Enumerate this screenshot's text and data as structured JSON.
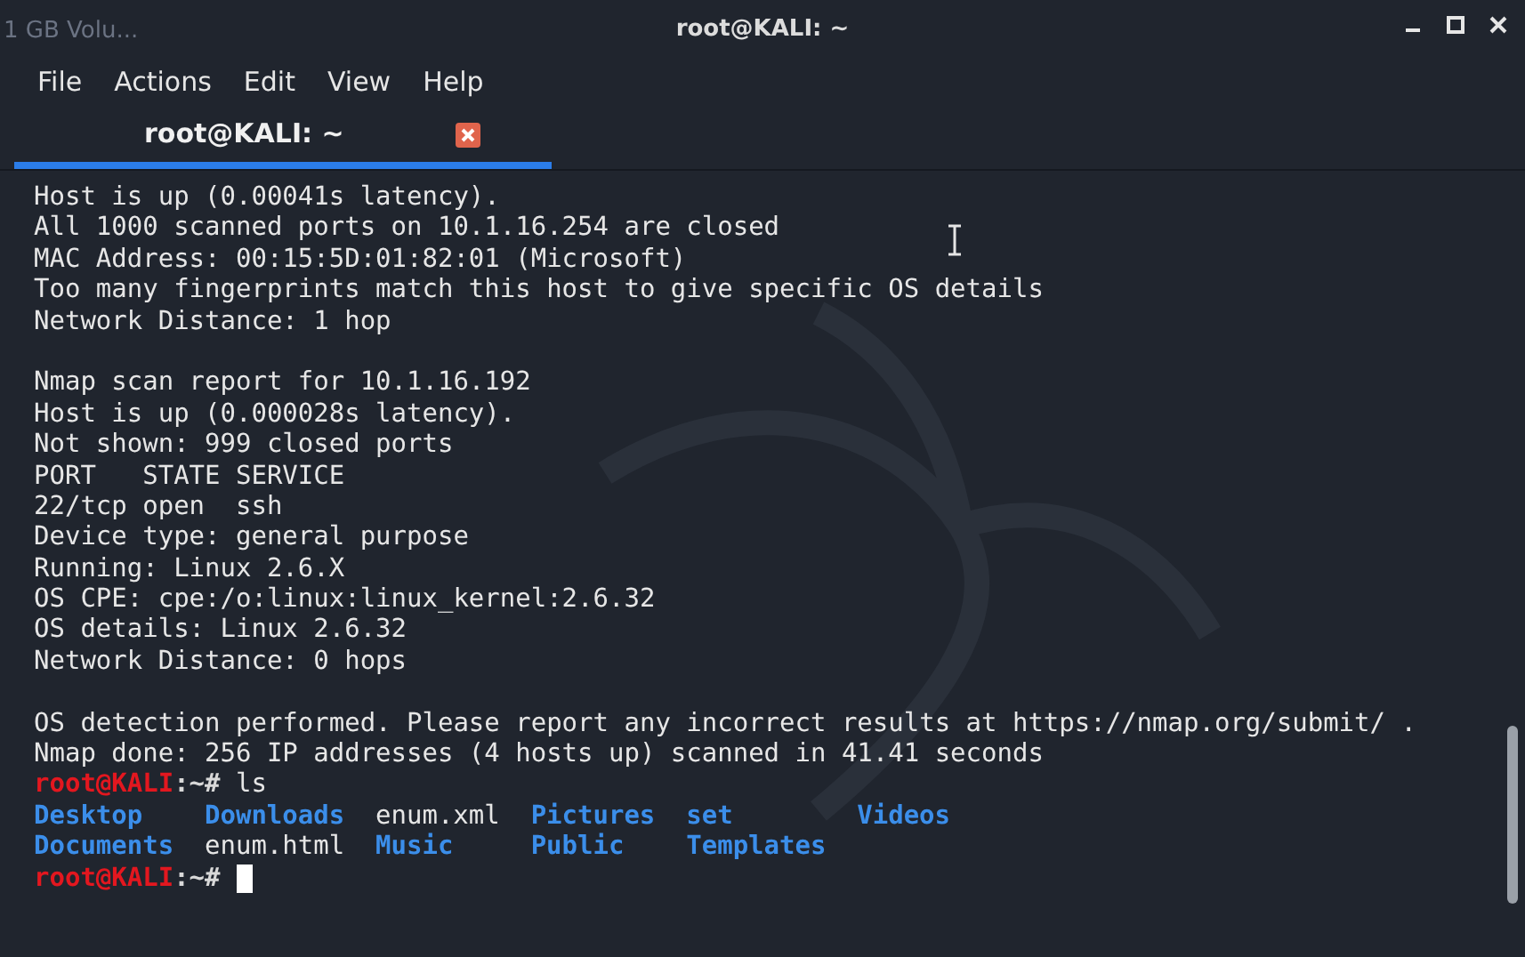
{
  "desktop": {
    "icon_label": "1 GB Volu..."
  },
  "window": {
    "title": "root@KALI: ~"
  },
  "menu": [
    "File",
    "Actions",
    "Edit",
    "View",
    "Help"
  ],
  "tabs": [
    {
      "label": "root@KALI: ~",
      "selected": true
    }
  ],
  "terminal": {
    "lines": [
      {
        "kind": "output",
        "text": "Host is up (0.00041s latency)."
      },
      {
        "kind": "output",
        "text": "All 1000 scanned ports on 10.1.16.254 are closed"
      },
      {
        "kind": "output",
        "text": "MAC Address: 00:15:5D:01:82:01 (Microsoft)"
      },
      {
        "kind": "output",
        "text": "Too many fingerprints match this host to give specific OS details"
      },
      {
        "kind": "output",
        "text": "Network Distance: 1 hop"
      },
      {
        "kind": "blank"
      },
      {
        "kind": "output",
        "text": "Nmap scan report for 10.1.16.192"
      },
      {
        "kind": "output",
        "text": "Host is up (0.000028s latency)."
      },
      {
        "kind": "output",
        "text": "Not shown: 999 closed ports"
      },
      {
        "kind": "output",
        "text": "PORT   STATE SERVICE"
      },
      {
        "kind": "output",
        "text": "22/tcp open  ssh"
      },
      {
        "kind": "output",
        "text": "Device type: general purpose"
      },
      {
        "kind": "output",
        "text": "Running: Linux 2.6.X"
      },
      {
        "kind": "output",
        "text": "OS CPE: cpe:/o:linux:linux_kernel:2.6.32"
      },
      {
        "kind": "output",
        "text": "OS details: Linux 2.6.32"
      },
      {
        "kind": "output",
        "text": "Network Distance: 0 hops"
      },
      {
        "kind": "blank"
      },
      {
        "kind": "output",
        "text": "OS detection performed. Please report any incorrect results at https://nmap.org/submit/ ."
      },
      {
        "kind": "output",
        "text": "Nmap done: 256 IP addresses (4 hosts up) scanned in 41.41 seconds"
      },
      {
        "kind": "prompt",
        "user": "root@KALI",
        "path": ":~#",
        "command": "ls",
        "cursor": false
      },
      {
        "kind": "listing",
        "entries": [
          {
            "text": "Desktop",
            "kind": "dir"
          },
          {
            "text": "Downloads",
            "kind": "dir"
          },
          {
            "text": "enum.xml",
            "kind": "file"
          },
          {
            "text": "Pictures",
            "kind": "dir"
          },
          {
            "text": "set",
            "kind": "dir"
          },
          {
            "text": "Videos",
            "kind": "dir"
          }
        ]
      },
      {
        "kind": "listing",
        "entries": [
          {
            "text": "Documents",
            "kind": "dir"
          },
          {
            "text": "enum.html",
            "kind": "file"
          },
          {
            "text": "Music",
            "kind": "dir"
          },
          {
            "text": "Public",
            "kind": "dir"
          },
          {
            "text": "Templates",
            "kind": "dir"
          }
        ]
      },
      {
        "kind": "prompt",
        "user": "root@KALI",
        "path": ":~#",
        "cursor": true
      }
    ]
  }
}
